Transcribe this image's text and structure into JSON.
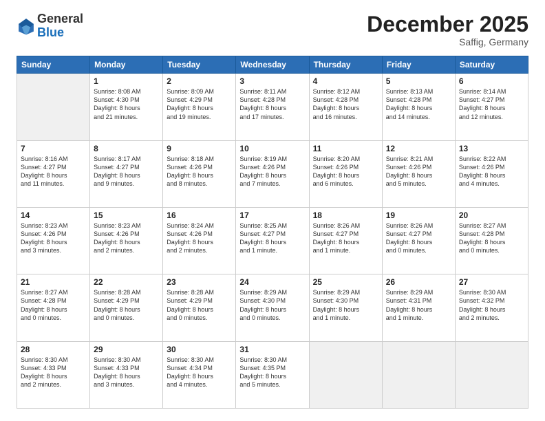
{
  "header": {
    "logo_general": "General",
    "logo_blue": "Blue",
    "month_title": "December 2025",
    "location": "Saffig, Germany"
  },
  "days_of_week": [
    "Sunday",
    "Monday",
    "Tuesday",
    "Wednesday",
    "Thursday",
    "Friday",
    "Saturday"
  ],
  "weeks": [
    [
      {
        "day": "",
        "text": ""
      },
      {
        "day": "1",
        "text": "Sunrise: 8:08 AM\nSunset: 4:30 PM\nDaylight: 8 hours\nand 21 minutes."
      },
      {
        "day": "2",
        "text": "Sunrise: 8:09 AM\nSunset: 4:29 PM\nDaylight: 8 hours\nand 19 minutes."
      },
      {
        "day": "3",
        "text": "Sunrise: 8:11 AM\nSunset: 4:28 PM\nDaylight: 8 hours\nand 17 minutes."
      },
      {
        "day": "4",
        "text": "Sunrise: 8:12 AM\nSunset: 4:28 PM\nDaylight: 8 hours\nand 16 minutes."
      },
      {
        "day": "5",
        "text": "Sunrise: 8:13 AM\nSunset: 4:28 PM\nDaylight: 8 hours\nand 14 minutes."
      },
      {
        "day": "6",
        "text": "Sunrise: 8:14 AM\nSunset: 4:27 PM\nDaylight: 8 hours\nand 12 minutes."
      }
    ],
    [
      {
        "day": "7",
        "text": "Sunrise: 8:16 AM\nSunset: 4:27 PM\nDaylight: 8 hours\nand 11 minutes."
      },
      {
        "day": "8",
        "text": "Sunrise: 8:17 AM\nSunset: 4:27 PM\nDaylight: 8 hours\nand 9 minutes."
      },
      {
        "day": "9",
        "text": "Sunrise: 8:18 AM\nSunset: 4:26 PM\nDaylight: 8 hours\nand 8 minutes."
      },
      {
        "day": "10",
        "text": "Sunrise: 8:19 AM\nSunset: 4:26 PM\nDaylight: 8 hours\nand 7 minutes."
      },
      {
        "day": "11",
        "text": "Sunrise: 8:20 AM\nSunset: 4:26 PM\nDaylight: 8 hours\nand 6 minutes."
      },
      {
        "day": "12",
        "text": "Sunrise: 8:21 AM\nSunset: 4:26 PM\nDaylight: 8 hours\nand 5 minutes."
      },
      {
        "day": "13",
        "text": "Sunrise: 8:22 AM\nSunset: 4:26 PM\nDaylight: 8 hours\nand 4 minutes."
      }
    ],
    [
      {
        "day": "14",
        "text": "Sunrise: 8:23 AM\nSunset: 4:26 PM\nDaylight: 8 hours\nand 3 minutes."
      },
      {
        "day": "15",
        "text": "Sunrise: 8:23 AM\nSunset: 4:26 PM\nDaylight: 8 hours\nand 2 minutes."
      },
      {
        "day": "16",
        "text": "Sunrise: 8:24 AM\nSunset: 4:26 PM\nDaylight: 8 hours\nand 2 minutes."
      },
      {
        "day": "17",
        "text": "Sunrise: 8:25 AM\nSunset: 4:27 PM\nDaylight: 8 hours\nand 1 minute."
      },
      {
        "day": "18",
        "text": "Sunrise: 8:26 AM\nSunset: 4:27 PM\nDaylight: 8 hours\nand 1 minute."
      },
      {
        "day": "19",
        "text": "Sunrise: 8:26 AM\nSunset: 4:27 PM\nDaylight: 8 hours\nand 0 minutes."
      },
      {
        "day": "20",
        "text": "Sunrise: 8:27 AM\nSunset: 4:28 PM\nDaylight: 8 hours\nand 0 minutes."
      }
    ],
    [
      {
        "day": "21",
        "text": "Sunrise: 8:27 AM\nSunset: 4:28 PM\nDaylight: 8 hours\nand 0 minutes."
      },
      {
        "day": "22",
        "text": "Sunrise: 8:28 AM\nSunset: 4:29 PM\nDaylight: 8 hours\nand 0 minutes."
      },
      {
        "day": "23",
        "text": "Sunrise: 8:28 AM\nSunset: 4:29 PM\nDaylight: 8 hours\nand 0 minutes."
      },
      {
        "day": "24",
        "text": "Sunrise: 8:29 AM\nSunset: 4:30 PM\nDaylight: 8 hours\nand 0 minutes."
      },
      {
        "day": "25",
        "text": "Sunrise: 8:29 AM\nSunset: 4:30 PM\nDaylight: 8 hours\nand 1 minute."
      },
      {
        "day": "26",
        "text": "Sunrise: 8:29 AM\nSunset: 4:31 PM\nDaylight: 8 hours\nand 1 minute."
      },
      {
        "day": "27",
        "text": "Sunrise: 8:30 AM\nSunset: 4:32 PM\nDaylight: 8 hours\nand 2 minutes."
      }
    ],
    [
      {
        "day": "28",
        "text": "Sunrise: 8:30 AM\nSunset: 4:33 PM\nDaylight: 8 hours\nand 2 minutes."
      },
      {
        "day": "29",
        "text": "Sunrise: 8:30 AM\nSunset: 4:33 PM\nDaylight: 8 hours\nand 3 minutes."
      },
      {
        "day": "30",
        "text": "Sunrise: 8:30 AM\nSunset: 4:34 PM\nDaylight: 8 hours\nand 4 minutes."
      },
      {
        "day": "31",
        "text": "Sunrise: 8:30 AM\nSunset: 4:35 PM\nDaylight: 8 hours\nand 5 minutes."
      },
      {
        "day": "",
        "text": ""
      },
      {
        "day": "",
        "text": ""
      },
      {
        "day": "",
        "text": ""
      }
    ]
  ]
}
